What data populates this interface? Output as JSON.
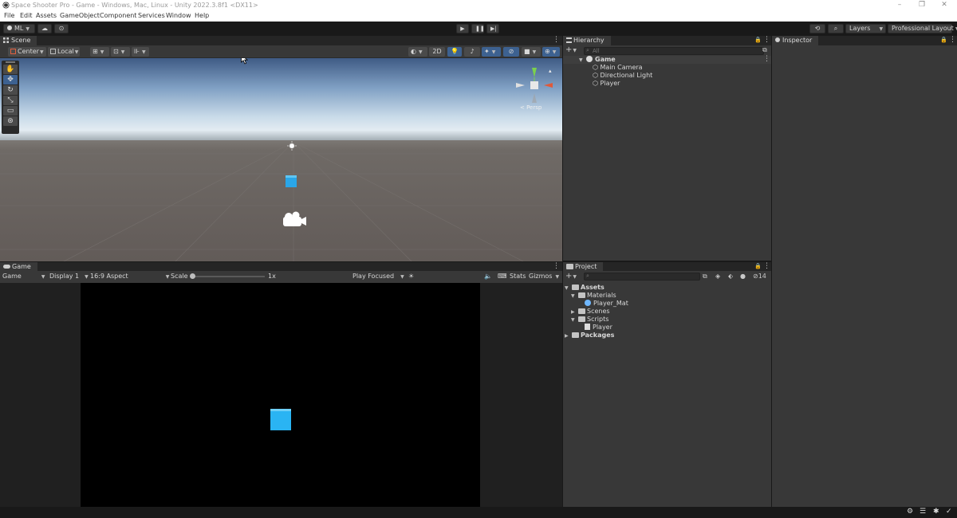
{
  "window": {
    "title": "Space Shooter Pro - Game - Windows, Mac, Linux - Unity 2022.3.8f1 <DX11>",
    "minimize": "–",
    "maximize": "❐",
    "close": "✕"
  },
  "menu": [
    "File",
    "Edit",
    "Assets",
    "GameObject",
    "Component",
    "Services",
    "Window",
    "Help"
  ],
  "toolbar": {
    "account_label": "ML",
    "layers_label": "Layers",
    "layout_label": "Professional Layout"
  },
  "scene": {
    "tab_label": "Scene",
    "pivot_label": "Center",
    "space_label": "Local",
    "mode_2d_label": "2D",
    "persp_label": "< Persp"
  },
  "game": {
    "tab_label": "Game",
    "view_select": "Game",
    "display_select": "Display 1",
    "aspect_select": "16:9 Aspect",
    "scale_label": "Scale",
    "scale_value": "1x",
    "play_mode_select": "Play Focused",
    "stats_label": "Stats",
    "gizmos_label": "Gizmos"
  },
  "hierarchy": {
    "tab_label": "Hierarchy",
    "search_placeholder": "All",
    "scene_name": "Game",
    "items": [
      "Main Camera",
      "Directional Light",
      "Player"
    ]
  },
  "project": {
    "tab_label": "Project",
    "hidden_count": "14",
    "assets_label": "Assets",
    "materials_label": "Materials",
    "player_mat_label": "Player_Mat",
    "scenes_label": "Scenes",
    "scripts_label": "Scripts",
    "player_script_label": "Player",
    "packages_label": "Packages"
  },
  "inspector": {
    "tab_label": "Inspector"
  },
  "colors": {
    "accent_blue": "#3d6190",
    "cube_blue": "#2bb3f2",
    "sky_top": "#3d5a86",
    "ground": "#6b6664"
  }
}
